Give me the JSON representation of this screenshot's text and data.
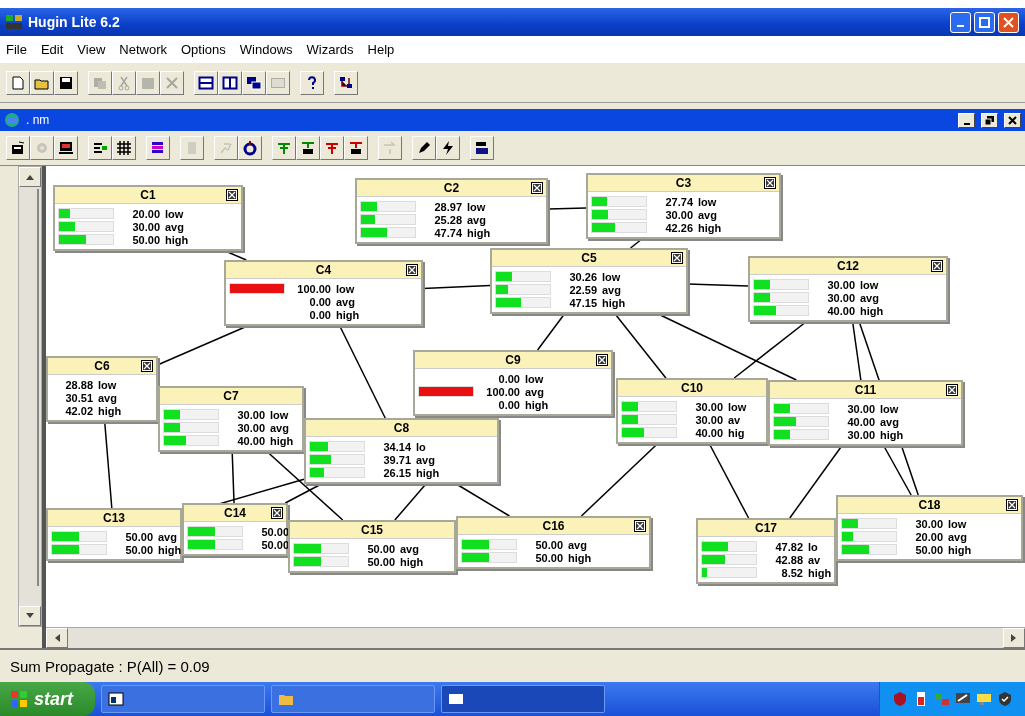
{
  "window": {
    "title": "Hugin Lite 6.2"
  },
  "menu": [
    "File",
    "Edit",
    "View",
    "Network",
    "Options",
    "Windows",
    "Wizards",
    "Help"
  ],
  "toolbar": [
    {
      "disabled": false
    },
    {
      "disabled": false
    },
    {
      "disabled": false
    },
    {
      "disabled": true
    },
    {
      "disabled": true
    },
    {
      "disabled": true
    },
    {
      "disabled": true
    },
    {
      "disabled": false
    },
    {
      "disabled": false
    },
    {
      "disabled": false
    },
    {
      "disabled": true
    },
    {
      "disabled": false
    },
    {
      "disabled": false
    }
  ],
  "document": {
    "title": ". nm",
    "toolbar": [
      {
        "disabled": false
      },
      {
        "disabled": true
      },
      {
        "disabled": false
      },
      {
        "disabled": false
      },
      {
        "disabled": false
      },
      {
        "disabled": false
      },
      {
        "disabled": true
      },
      {
        "disabled": true
      },
      {
        "disabled": false
      },
      {
        "disabled": false
      },
      {
        "disabled": false
      },
      {
        "disabled": false
      },
      {
        "disabled": false
      },
      {
        "disabled": true
      },
      {
        "disabled": false
      },
      {
        "disabled": false
      },
      {
        "disabled": false
      }
    ]
  },
  "nodes": [
    {
      "name": "C1",
      "evidence": false,
      "close_button": true,
      "rows": [
        {
          "value": "20.00",
          "state": "low",
          "level": 0.2
        },
        {
          "value": "30.00",
          "state": "avg",
          "level": 0.3
        },
        {
          "value": "50.00",
          "state": "high",
          "level": 0.5
        }
      ]
    },
    {
      "name": "C2",
      "evidence": false,
      "close_button": true,
      "rows": [
        {
          "value": "28.97",
          "state": "low",
          "level": 0.2897
        },
        {
          "value": "25.28",
          "state": "avg",
          "level": 0.2528
        },
        {
          "value": "47.74",
          "state": "high",
          "level": 0.4774
        }
      ]
    },
    {
      "name": "C3",
      "evidence": false,
      "close_button": true,
      "rows": [
        {
          "value": "27.74",
          "state": "low",
          "level": 0.2774
        },
        {
          "value": "30.00",
          "state": "avg",
          "level": 0.3
        },
        {
          "value": "42.26",
          "state": "high",
          "level": 0.4226
        }
      ]
    },
    {
      "name": "C4",
      "evidence": true,
      "close_button": true,
      "rows": [
        {
          "value": "100.00",
          "state": "low",
          "level": 1
        },
        {
          "value": "0.00",
          "state": "avg"
        },
        {
          "value": "0.00",
          "state": "high"
        }
      ]
    },
    {
      "name": "C5",
      "evidence": false,
      "close_button": true,
      "rows": [
        {
          "value": "30.26",
          "state": "low",
          "level": 0.3026
        },
        {
          "value": "22.59",
          "state": "avg",
          "level": 0.2259
        },
        {
          "value": "47.15",
          "state": "high",
          "level": 0.4715
        }
      ]
    },
    {
      "name": "C12",
      "evidence": false,
      "close_button": true,
      "rows": [
        {
          "value": "30.00",
          "state": "low",
          "level": 0.3
        },
        {
          "value": "30.00",
          "state": "avg",
          "level": 0.3
        },
        {
          "value": "40.00",
          "state": "high",
          "level": 0.4
        }
      ]
    },
    {
      "name": "C6",
      "close_button": true,
      "rows": [
        {
          "value": "28.88",
          "state": "low"
        },
        {
          "value": "30.51",
          "state": "avg"
        },
        {
          "value": "42.02",
          "state": "high"
        }
      ]
    },
    {
      "name": "C7",
      "evidence": false,
      "close_button": false,
      "rows": [
        {
          "value": "30.00",
          "state": "low",
          "level": 0.3
        },
        {
          "value": "30.00",
          "state": "avg",
          "level": 0.3
        },
        {
          "value": "40.00",
          "state": "high",
          "level": 0.4
        }
      ]
    },
    {
      "name": "C8",
      "evidence": false,
      "close_button": false,
      "rows": [
        {
          "value": "34.14",
          "state": "lo",
          "level": 0.3414
        },
        {
          "value": "39.71",
          "state": "avg",
          "level": 0.3971
        },
        {
          "value": "26.15",
          "state": "high",
          "level": 0.2615
        }
      ]
    },
    {
      "name": "C9",
      "evidence": true,
      "close_button": true,
      "rows": [
        {
          "value": "0.00",
          "state": "low"
        },
        {
          "value": "100.00",
          "state": "avg",
          "level": 1
        },
        {
          "value": "0.00",
          "state": "high"
        }
      ]
    },
    {
      "name": "C10",
      "evidence": false,
      "close_button": false,
      "rows": [
        {
          "value": "30.00",
          "state": "low",
          "level": 0.3
        },
        {
          "value": "30.00",
          "state": "av",
          "level": 0.3
        },
        {
          "value": "40.00",
          "state": "hig",
          "level": 0.4
        }
      ]
    },
    {
      "name": "C11",
      "evidence": false,
      "close_button": true,
      "rows": [
        {
          "value": "30.00",
          "state": "low",
          "level": 0.3
        },
        {
          "value": "40.00",
          "state": "avg",
          "level": 0.4
        },
        {
          "value": "30.00",
          "state": "high",
          "level": 0.3
        }
      ]
    },
    {
      "name": "C13",
      "evidence": false,
      "close_button": false,
      "rows": [
        {
          "value": "50.00",
          "state": "avg",
          "level": 0.5
        },
        {
          "value": "50.00",
          "state": "high",
          "level": 0.5
        }
      ]
    },
    {
      "name": "C14",
      "evidence": false,
      "close_button": true,
      "rows": [
        {
          "value": "50.00",
          "level": 0.5
        },
        {
          "value": "50.00",
          "level": 0.5
        }
      ]
    },
    {
      "name": "C15",
      "evidence": false,
      "close_button": false,
      "rows": [
        {
          "value": "50.00",
          "state": "avg",
          "level": 0.5
        },
        {
          "value": "50.00",
          "state": "high",
          "level": 0.5
        }
      ]
    },
    {
      "name": "C16",
      "evidence": false,
      "close_button": true,
      "rows": [
        {
          "value": "50.00",
          "state": "avg",
          "level": 0.5
        },
        {
          "value": "50.00",
          "state": "high",
          "level": 0.5
        }
      ]
    },
    {
      "name": "C17",
      "evidence": false,
      "close_button": false,
      "rows": [
        {
          "value": "47.82",
          "state": "lo",
          "level": 0.4782
        },
        {
          "value": "42.88",
          "state": "av",
          "level": 0.4288
        },
        {
          "value": "8.52",
          "state": "high",
          "level": 0.0852
        }
      ]
    },
    {
      "name": "C18",
      "evidence": false,
      "close_button": true,
      "rows": [
        {
          "value": "30.00",
          "state": "low",
          "level": 0.3
        },
        {
          "value": "20.00",
          "state": "avg",
          "level": 0.2
        },
        {
          "value": "50.00",
          "state": "high",
          "level": 0.5
        }
      ]
    }
  ],
  "status_bar": "Sum Propagate : P(All) = 0.09",
  "taskbar": {
    "start": "start"
  }
}
